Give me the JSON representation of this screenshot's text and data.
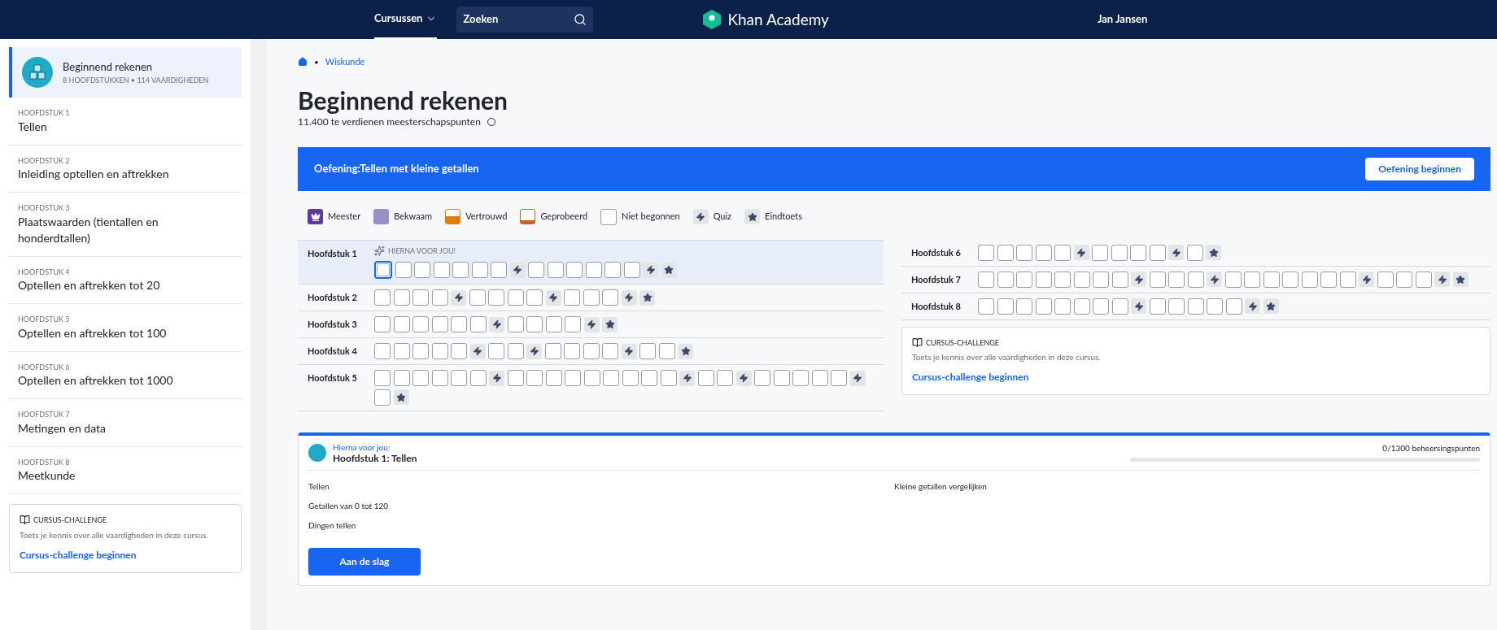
{
  "nav": {
    "courses": "Cursussen",
    "search_placeholder": "Zoeken",
    "logo": "Khan Academy",
    "user": "Jan Jansen"
  },
  "sidebar": {
    "course": {
      "title": "Beginnend rekenen",
      "subtitle": "8 HOOFDSTUKKEN • 114 VAARDIGHEDEN",
      "selected": true
    },
    "items": [
      {
        "label": "HOOFDSTUK 1",
        "title": "Tellen"
      },
      {
        "label": "HOOFDSTUK 2",
        "title": "Inleiding optellen en aftrekken"
      },
      {
        "label": "HOOFDSTUK 3",
        "title": "Plaatswaarden (tientallen en honderdtallen)"
      },
      {
        "label": "HOOFDSTUK 4",
        "title": "Optellen en aftrekken tot 20"
      },
      {
        "label": "HOOFDSTUK 5",
        "title": "Optellen en aftrekken tot 100"
      },
      {
        "label": "HOOFDSTUK 6",
        "title": "Optellen en aftrekken tot 1000"
      },
      {
        "label": "HOOFDSTUK 7",
        "title": "Metingen en data"
      },
      {
        "label": "HOOFDSTUK 8",
        "title": "Meetkunde"
      }
    ],
    "challenge": {
      "title": "CURSUS-CHALLENGE",
      "text": "Toets je kennis over alle vaardigheden in deze cursus.",
      "link": "Cursus-challenge beginnen"
    }
  },
  "breadcrumb": {
    "separator": "•",
    "items": [
      "Wiskunde"
    ]
  },
  "title": "Beginnend rekenen",
  "subtitle": "11.400 te verdienen meesterschapspunten",
  "banner": {
    "text": "Oefening:Tellen met kleine getallen",
    "button": "Oefening beginnen"
  },
  "legend": [
    {
      "kind": "mastered",
      "label": "Meester"
    },
    {
      "kind": "proficient",
      "label": "Bekwaam"
    },
    {
      "kind": "familiar",
      "label": "Vertrouwd"
    },
    {
      "kind": "attempted",
      "label": "Geprobeerd"
    },
    {
      "kind": "skill",
      "label": "Niet begonnen"
    },
    {
      "kind": "quiz",
      "label": "Quiz"
    },
    {
      "kind": "test",
      "label": "Eindtoets"
    }
  ],
  "chapters_left": [
    {
      "name": "Hoofdstuk 1",
      "selected": true,
      "hint": "HIERNA VOOR JOU!",
      "skills": [
        {
          "kind": "current"
        },
        {
          "kind": "skill"
        },
        {
          "kind": "skill"
        },
        {
          "kind": "skill"
        },
        {
          "kind": "skill"
        },
        {
          "kind": "skill"
        },
        {
          "kind": "skill"
        },
        {
          "kind": "quiz"
        },
        {
          "kind": "skill"
        },
        {
          "kind": "skill"
        },
        {
          "kind": "skill"
        },
        {
          "kind": "skill"
        },
        {
          "kind": "skill"
        },
        {
          "kind": "skill"
        },
        {
          "kind": "quiz"
        },
        {
          "kind": "test"
        }
      ]
    },
    {
      "name": "Hoofdstuk 2",
      "selected": false,
      "skills": [
        {
          "kind": "skill"
        },
        {
          "kind": "skill"
        },
        {
          "kind": "skill"
        },
        {
          "kind": "skill"
        },
        {
          "kind": "quiz"
        },
        {
          "kind": "skill"
        },
        {
          "kind": "skill"
        },
        {
          "kind": "skill"
        },
        {
          "kind": "skill"
        },
        {
          "kind": "quiz"
        },
        {
          "kind": "skill"
        },
        {
          "kind": "skill"
        },
        {
          "kind": "skill"
        },
        {
          "kind": "quiz"
        },
        {
          "kind": "test"
        }
      ]
    },
    {
      "name": "Hoofdstuk 3",
      "selected": false,
      "skills": [
        {
          "kind": "skill"
        },
        {
          "kind": "skill"
        },
        {
          "kind": "skill"
        },
        {
          "kind": "skill"
        },
        {
          "kind": "skill"
        },
        {
          "kind": "skill"
        },
        {
          "kind": "quiz"
        },
        {
          "kind": "skill"
        },
        {
          "kind": "skill"
        },
        {
          "kind": "skill"
        },
        {
          "kind": "skill"
        },
        {
          "kind": "quiz"
        },
        {
          "kind": "test"
        }
      ]
    },
    {
      "name": "Hoofdstuk 4",
      "selected": false,
      "skills": [
        {
          "kind": "skill"
        },
        {
          "kind": "skill"
        },
        {
          "kind": "skill"
        },
        {
          "kind": "skill"
        },
        {
          "kind": "skill"
        },
        {
          "kind": "quiz"
        },
        {
          "kind": "skill"
        },
        {
          "kind": "skill"
        },
        {
          "kind": "quiz"
        },
        {
          "kind": "skill"
        },
        {
          "kind": "skill"
        },
        {
          "kind": "skill"
        },
        {
          "kind": "skill"
        },
        {
          "kind": "quiz"
        },
        {
          "kind": "skill"
        },
        {
          "kind": "skill"
        },
        {
          "kind": "test"
        }
      ]
    },
    {
      "name": "Hoofdstuk 5",
      "selected": false,
      "skills": [
        {
          "kind": "skill"
        },
        {
          "kind": "skill"
        },
        {
          "kind": "skill"
        },
        {
          "kind": "skill"
        },
        {
          "kind": "skill"
        },
        {
          "kind": "skill"
        },
        {
          "kind": "quiz"
        },
        {
          "kind": "skill"
        },
        {
          "kind": "skill"
        },
        {
          "kind": "skill"
        },
        {
          "kind": "skill"
        },
        {
          "kind": "skill"
        },
        {
          "kind": "skill"
        },
        {
          "kind": "skill"
        },
        {
          "kind": "skill"
        },
        {
          "kind": "skill"
        },
        {
          "kind": "quiz"
        },
        {
          "kind": "skill"
        },
        {
          "kind": "skill"
        },
        {
          "kind": "quiz"
        },
        {
          "kind": "skill"
        },
        {
          "kind": "skill"
        },
        {
          "kind": "skill"
        },
        {
          "kind": "skill"
        },
        {
          "kind": "skill"
        },
        {
          "kind": "quiz"
        },
        {
          "kind": "skill"
        },
        {
          "kind": "test"
        }
      ]
    }
  ],
  "chapters_right": [
    {
      "name": "Hoofdstuk 6",
      "selected": false,
      "skills": [
        {
          "kind": "skill"
        },
        {
          "kind": "skill"
        },
        {
          "kind": "skill"
        },
        {
          "kind": "skill"
        },
        {
          "kind": "skill"
        },
        {
          "kind": "quiz"
        },
        {
          "kind": "skill"
        },
        {
          "kind": "skill"
        },
        {
          "kind": "skill"
        },
        {
          "kind": "skill"
        },
        {
          "kind": "quiz"
        },
        {
          "kind": "skill"
        },
        {
          "kind": "test"
        }
      ]
    },
    {
      "name": "Hoofdstuk 7",
      "selected": false,
      "skills": [
        {
          "kind": "skill"
        },
        {
          "kind": "skill"
        },
        {
          "kind": "skill"
        },
        {
          "kind": "skill"
        },
        {
          "kind": "skill"
        },
        {
          "kind": "skill"
        },
        {
          "kind": "skill"
        },
        {
          "kind": "skill"
        },
        {
          "kind": "quiz"
        },
        {
          "kind": "skill"
        },
        {
          "kind": "skill"
        },
        {
          "kind": "skill"
        },
        {
          "kind": "quiz"
        },
        {
          "kind": "skill"
        },
        {
          "kind": "skill"
        },
        {
          "kind": "skill"
        },
        {
          "kind": "skill"
        },
        {
          "kind": "skill"
        },
        {
          "kind": "skill"
        },
        {
          "kind": "skill"
        },
        {
          "kind": "quiz"
        },
        {
          "kind": "skill"
        },
        {
          "kind": "skill"
        },
        {
          "kind": "skill"
        },
        {
          "kind": "quiz"
        },
        {
          "kind": "test"
        }
      ]
    },
    {
      "name": "Hoofdstuk 8",
      "selected": false,
      "skills": [
        {
          "kind": "skill"
        },
        {
          "kind": "skill"
        },
        {
          "kind": "skill"
        },
        {
          "kind": "skill"
        },
        {
          "kind": "skill"
        },
        {
          "kind": "skill"
        },
        {
          "kind": "skill"
        },
        {
          "kind": "skill"
        },
        {
          "kind": "quiz"
        },
        {
          "kind": "skill"
        },
        {
          "kind": "skill"
        },
        {
          "kind": "skill"
        },
        {
          "kind": "skill"
        },
        {
          "kind": "skill"
        },
        {
          "kind": "quiz"
        },
        {
          "kind": "test"
        }
      ]
    }
  ],
  "challenge": {
    "title": "CURSUS-CHALLENGE",
    "text": "Toets je kennis over alle vaardigheden in deze cursus.",
    "link": "Cursus-challenge beginnen"
  },
  "next": {
    "label": "Hierna voor jou:",
    "title": "Hoofdstuk 1: Tellen",
    "points": "0/1300 beheersingspunten",
    "level": 0,
    "skills_left": [
      "Tellen",
      "Getallen van 0 tot 120",
      "Dingen tellen"
    ],
    "skills_right": [
      "Kleine getallen vergelijken"
    ],
    "button": "Aan de slag"
  }
}
